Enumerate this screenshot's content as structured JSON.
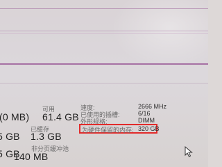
{
  "colors": {
    "highlight_red": "#e22b2b",
    "graph_line": "#9c5f9a"
  },
  "left": {
    "in_use_value": "(0 MB)",
    "committed_value": "5 GB",
    "paged_value": "5 GB",
    "non_paged_value": "140 MB"
  },
  "middle": {
    "available_label": "可用",
    "available_value": "61.4 GB",
    "cached_label": "已缓存",
    "cached_value": "1.3 GB",
    "non_paged_label": "非分页缓冲池",
    "non_paged_value": "140 MB"
  },
  "details": {
    "speed_label": "速度:",
    "speed_value": "2666 MHz",
    "slots_label": "已使用的插槽:",
    "slots_value": "6/16",
    "form_label": "外形规格:",
    "form_value": "DIMM",
    "reserved_label": "为硬件保留的内存:",
    "reserved_value": "320 GB"
  },
  "icons": {
    "cursor": "mouse-cursor-icon"
  }
}
